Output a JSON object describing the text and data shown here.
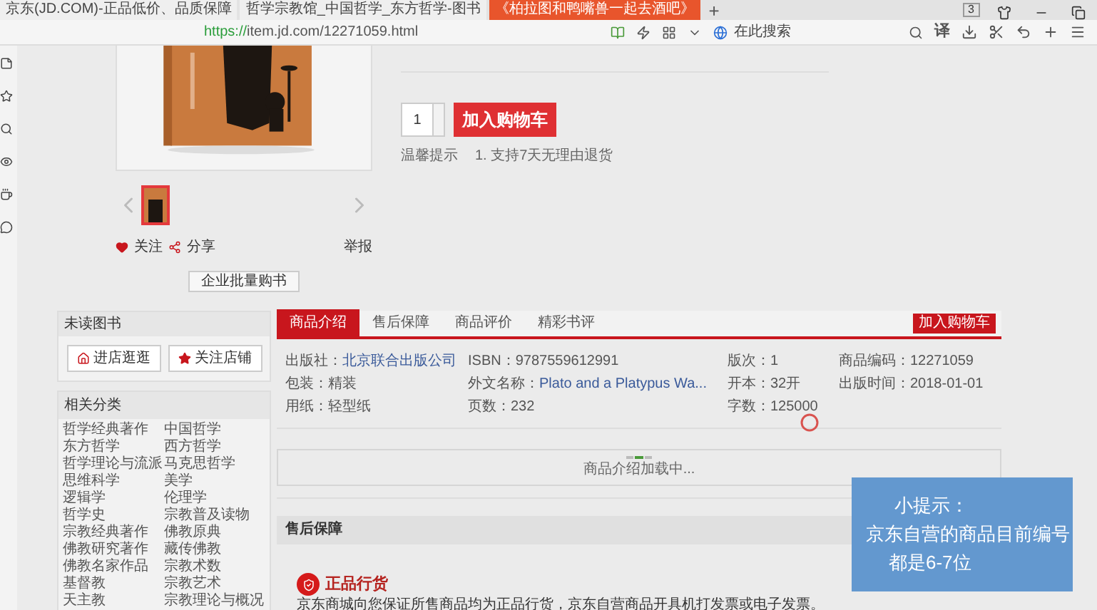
{
  "browser": {
    "tabs": [
      {
        "title": "京东(JD.COM)-正品低价、品质保障",
        "selected": false
      },
      {
        "title": "哲学宗教馆_中国哲学_东方哲学-图书",
        "selected": false
      },
      {
        "title": "《柏拉图和鸭嘴兽一起去酒吧》",
        "selected": true
      }
    ],
    "new_tab": "+",
    "window_count": "3",
    "url_scheme": "https://",
    "url_rest": "item.jd.com/12271059.html",
    "search_placeholder": "在此搜索",
    "translate": "译"
  },
  "product": {
    "quantity": "1",
    "add_to_cart": "加入购物车",
    "hint_label": "温馨提示",
    "hint_text": "1. 支持7天无理由退货",
    "follow": "关注",
    "share": "分享",
    "report": "举报",
    "bulk_buy": "企业批量购书"
  },
  "shop": {
    "title": "未读图书",
    "buttons": [
      "进店逛逛",
      "关注店铺"
    ]
  },
  "categories": {
    "title": "相关分类",
    "items": [
      "哲学经典著作",
      "中国哲学",
      "东方哲学",
      "西方哲学",
      "哲学理论与流派",
      "马克思哲学",
      "思维科学",
      "美学",
      "逻辑学",
      "伦理学",
      "哲学史",
      "宗教普及读物",
      "宗教经典著作",
      "佛教原典",
      "佛教研究著作",
      "藏传佛教",
      "佛教名家作品",
      "宗教术数",
      "基督教",
      "宗教艺术",
      "天主教",
      "宗教理论与概况"
    ]
  },
  "detail_tabs": [
    {
      "label": "商品介绍",
      "selected": true
    },
    {
      "label": "售后保障",
      "selected": false
    },
    {
      "label": "商品评价",
      "selected": false
    },
    {
      "label": "精彩书评",
      "selected": false
    }
  ],
  "detail_cart_button": "加入购物车",
  "specs": [
    {
      "label": "出版社：",
      "value": "北京联合出版公司",
      "link": true
    },
    {
      "label": "ISBN：",
      "value": "9787559612991",
      "link": false
    },
    {
      "label": "版次：",
      "value": "1",
      "link": false
    },
    {
      "label": "商品编码：",
      "value": "12271059",
      "link": false
    },
    {
      "label": "包装：",
      "value": "精装",
      "link": false
    },
    {
      "label": "外文名称：",
      "value": "Plato and a Platypus Wa...",
      "link": true
    },
    {
      "label": "开本：",
      "value": "32开",
      "link": false
    },
    {
      "label": "出版时间：",
      "value": "2018-01-01",
      "link": false
    },
    {
      "label": "用纸：",
      "value": "轻型纸",
      "link": false
    },
    {
      "label": "页数：",
      "value": "232",
      "link": false
    },
    {
      "label": "字数：",
      "value": "125000",
      "link": false
    }
  ],
  "loading_text": "商品介绍加载中...",
  "after_sale": {
    "title": "售后保障",
    "badge_title": "正品行货",
    "description": "京东商城向您保证所售商品均为正品行货，京东自营商品开具机打发票或电子发票。"
  },
  "tip": {
    "lines": [
      "小提示：",
      "京东自营的商品目前编号",
      "都是6-7位"
    ]
  }
}
